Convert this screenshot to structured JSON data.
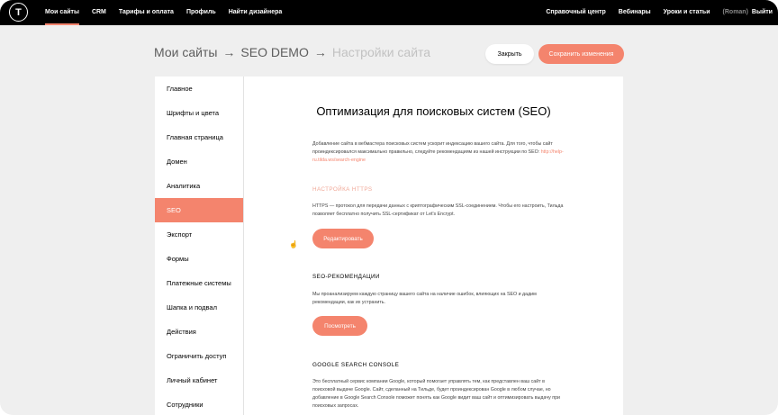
{
  "topbar": {
    "logo_letter": "T",
    "nav_left": [
      "Мои сайты",
      "CRM",
      "Тарифы и оплата",
      "Профиль",
      "Найти дизайнера"
    ],
    "nav_right": [
      "Справочный центр",
      "Вебинары",
      "Уроки и статьи"
    ],
    "user": "(Roman)",
    "logout": "Выйти",
    "accent": "#f4846d"
  },
  "header": {
    "breadcrumb": [
      "Мои сайты",
      "SEO DEMO",
      "Настройки сайта"
    ],
    "separator": "→",
    "close_label": "Закрыть",
    "save_label": "Сохранить изменения"
  },
  "sidebar": {
    "items": [
      "Главное",
      "Шрифты и цвета",
      "Главная страница",
      "Домен",
      "Аналитика",
      "SEO",
      "Экспорт",
      "Формы",
      "Платежные системы",
      "Шапка и подвал",
      "Действия",
      "Ограничить доступ",
      "Личный кабинет",
      "Сотрудники"
    ],
    "active": "SEO"
  },
  "main": {
    "title": "Оптимизация для поисковых систем (SEO)",
    "intro": "Добавление сайта в вебмастера поисковых систем ускорит индексацию вашего сайта. Для того, чтобы сайт проиндексировался максимально правильно, следуйте рекомендациям из нашей инструкции по SEO:",
    "intro_link": "http://help-ru.tilda.ws/search-engine",
    "https_heading": "НАСТРОЙКА HTTPS",
    "https_text": "HTTPS — протокол для передачи данных с криптографическим SSL-соединением. Чтобы его настроить, Тильда позволяет бесплатно получить SSL-сертификат от Let's Encrypt.",
    "https_button": "Редактировать",
    "seo_heading": "SEO-РЕКОМЕНДАЦИИ",
    "seo_text": "Мы проанализируем каждую страницу вашего сайта на наличие ошибок, влияющих на SEO и дадим рекомендации, как их устранить.",
    "seo_button": "Посмотреть",
    "gsc_heading": "GOOGLE SEARCH CONSOLE",
    "gsc_text": "Это бесплатный сервис компании Google, который помогает управлять тем, как представлен ваш сайт в поисковой выдаче Google. Сайт, сделанный на Тильде, будет проиндексирован Google в любом случае, но добавление в Google Search Console поможет понять как Google видит ваш сайт и оптимизировать выдачу при поисковых запросах."
  }
}
